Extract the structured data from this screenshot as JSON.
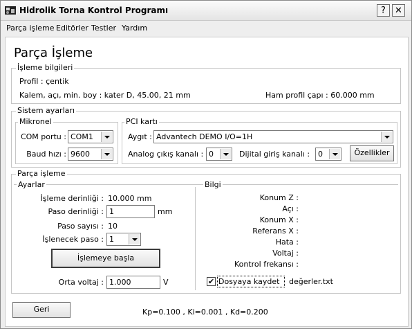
{
  "window": {
    "title": "Hidrolik Torna Kontrol Programı",
    "help_glyph": "?",
    "close_glyph": "✕"
  },
  "menu": [
    "Parça işleme",
    "Editörler",
    "Testler",
    "Yardım"
  ],
  "page_title": "Parça İşleme",
  "isleme_bilgileri": {
    "legend": "İşleme bilgileri",
    "profil": "Profil : çentik",
    "kalem": "Kalem, açı, min. boy : kater D, 45.00, 21 mm",
    "ham_profil": "Ham profil çapı : 60.000 mm"
  },
  "sistem": {
    "legend": "Sistem ayarları",
    "mikronel": {
      "legend": "Mikronel",
      "com_label": "COM portu :",
      "com_value": "COM1",
      "baud_label": "Baud hızı :",
      "baud_value": "9600"
    },
    "pci": {
      "legend": "PCI kartı",
      "aygit_label": "Aygıt :",
      "aygit_value": "Advantech DEMO I/O=1H",
      "analog_label": "Analog çıkış kanalı :",
      "analog_value": "0",
      "dijital_label": "Dijital giriş kanalı :",
      "dijital_value": "0",
      "ozellikler": "Özellikler"
    }
  },
  "parca": {
    "legend": "Parça işleme",
    "ayarlar": {
      "legend": "Ayarlar",
      "derinlik_label": "İşleme derinliği :",
      "derinlik_value": "10.000 mm",
      "paso_derinligi_label": "Paso derinliği :",
      "paso_derinligi_value": "1",
      "paso_derinligi_unit": "mm",
      "paso_sayisi_label": "Paso sayısı :",
      "paso_sayisi_value": "10",
      "islenecek_label": "İşlenecek paso :",
      "islenecek_value": "1",
      "button": "İşlemeye başla",
      "orta_label": "Orta voltaj :",
      "orta_value": "1.000",
      "orta_unit": "V"
    },
    "bilgi": {
      "legend": "Bilgi",
      "rows": [
        "Konum Z :",
        "Açı :",
        "Konum X :",
        "Referans X :",
        "Hata :",
        "Voltaj :",
        "Kontrol frekansı :"
      ],
      "checkbox_mark": "✔",
      "checkbox_label": "Dosyaya kaydet",
      "file_name": "değerler.txt"
    }
  },
  "footer": {
    "geri": "Geri",
    "kp": "Kp=0.100 , Ki=0.001 , Kd=0.200"
  }
}
